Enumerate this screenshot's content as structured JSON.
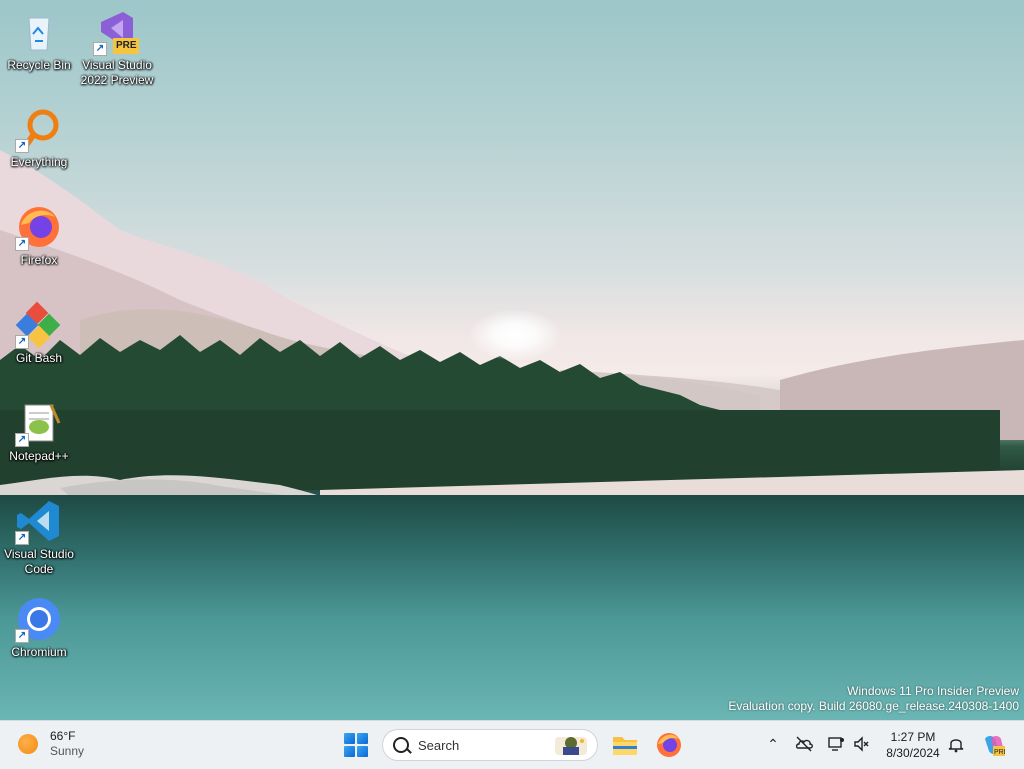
{
  "desktop_icons": [
    {
      "label": "Recycle Bin",
      "icon": "recycle-bin-icon"
    },
    {
      "label": "Visual Studio 2022 Preview",
      "icon": "visual-studio-preview-icon",
      "badge": "PRE"
    },
    {
      "label": "Everything",
      "icon": "everything-search-icon"
    },
    {
      "label": "Firefox",
      "icon": "firefox-icon"
    },
    {
      "label": "Git Bash",
      "icon": "git-bash-icon"
    },
    {
      "label": "Notepad++",
      "icon": "notepadpp-icon"
    },
    {
      "label": "Visual Studio Code",
      "icon": "vscode-icon"
    },
    {
      "label": "Chromium",
      "icon": "chromium-icon"
    }
  ],
  "watermark": {
    "line1": "Windows 11 Pro Insider Preview",
    "line2": "Evaluation copy. Build 26080.ge_release.240308-1400"
  },
  "taskbar": {
    "weather": {
      "temp": "66°F",
      "condition": "Sunny"
    },
    "search_placeholder": "Search",
    "pinned": [
      "start-button",
      "file-explorer",
      "firefox"
    ],
    "clock": {
      "time": "1:27 PM",
      "date": "8/30/2024"
    }
  },
  "colors": {
    "taskbar_bg": "#eef1f4",
    "accent": "#0a66d6"
  }
}
